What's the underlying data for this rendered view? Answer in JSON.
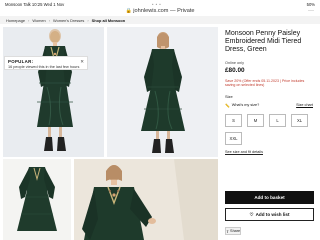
{
  "status_bar": {
    "left": "Monsoon Talk  10:25   Wed 1 Nov",
    "center": "• • •",
    "right": "50%"
  },
  "address_bar": {
    "url": "johnlewis.com — Private",
    "menu": "···"
  },
  "breadcrumb": [
    "Homepage",
    "Women",
    "Women's Dresses",
    "Shop all Monsoon"
  ],
  "popular": {
    "title": "POPULAR:",
    "text": "16 people viewed this in the last few hours",
    "close": "✕"
  },
  "product": {
    "title": "Monsoon Penny Paisley Embroidered Midi Tiered Dress, Green",
    "availability": "Online only",
    "price": "£80.00",
    "offer": "Save 20% (Offer ends 05.11.2023 | Price includes saving on selected lines)",
    "size_label": "Size",
    "whats_my_size": "What's my size?",
    "size_chart": "Size chart",
    "sizes": [
      "S",
      "M",
      "L",
      "XL",
      "XXL"
    ],
    "size_fit_link": "See size and fit details",
    "add_to_basket": "Add to basket",
    "add_to_wishlist": "Add to wish list",
    "share": "Share"
  },
  "colors": {
    "dress_green": "#1f3a2c",
    "offer_red": "#c0392b",
    "button_black": "#111111"
  }
}
